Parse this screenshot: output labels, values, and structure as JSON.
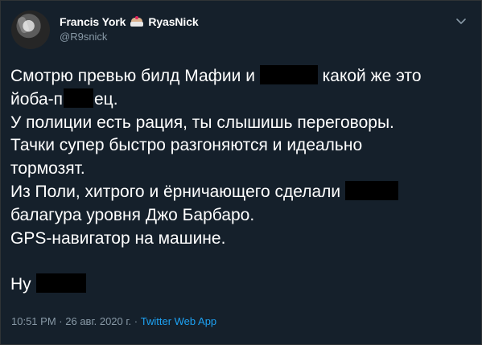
{
  "user": {
    "display_name_part1": "Francis York",
    "display_name_part2": "RyasNick",
    "handle": "@R9snick",
    "avatar_icon": "avatar",
    "emoji_icon": "cake-icon"
  },
  "menu": {
    "icon": "chevron-down-icon"
  },
  "tweet": {
    "line1_a": "Смотрю превью билд Мафии и",
    "line1_b": "какой же это",
    "line2_a": "йоба-п",
    "line2_b": "ец.",
    "line3": "У полиции есть рация, ты слышишь переговоры.",
    "line4": "Тачки супер быстро разгоняются и идеально",
    "line5": "тормозят.",
    "line6": "Из Поли, хитрого и ёрничающего сделали",
    "line7": "балагура уровня Джо Барбаро.",
    "line8": "GPS-навигатор на машине.",
    "line9": "Ну"
  },
  "meta": {
    "time": "10:51 PM",
    "separator": "·",
    "date": "26 авг. 2020 г.",
    "app": "Twitter Web App"
  },
  "colors": {
    "background": "#15202b",
    "text": "#ffffff",
    "secondary": "#8899a6",
    "link": "#1da1f2",
    "redaction": "#000000"
  }
}
